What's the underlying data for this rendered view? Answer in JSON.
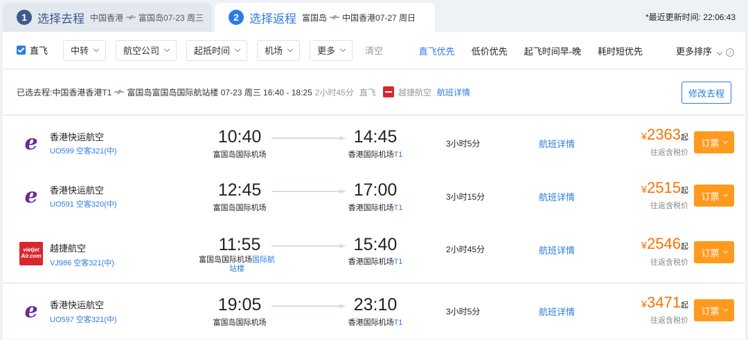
{
  "steps": [
    {
      "num": "1",
      "title": "选择去程",
      "from": "中国香港",
      "to": "富国岛07-23 周三"
    },
    {
      "num": "2",
      "title": "选择返程",
      "from": "富国岛",
      "to": "中国香港07-27 周日"
    }
  ],
  "update_time": "*最近更新时间: 22:06:43",
  "filters": {
    "direct_label": "直飞",
    "direct_checked": true,
    "dropdowns": [
      "中转",
      "航空公司",
      "起抵时间",
      "机场",
      "更多"
    ],
    "clear": "清空"
  },
  "sorts": [
    "直飞优先",
    "低价优先",
    "起飞时间早-晚",
    "耗时短优先",
    "更多排序"
  ],
  "active_sort": "直飞优先",
  "selected": {
    "prefix": "已选去程: ",
    "from": "中国香港香港T1",
    "to": "富国岛富国岛国际航站楼 07-23 周三 16:40 - 18:25",
    "duration": "2小时45分",
    "type": "直飞",
    "airline": "越捷航空",
    "detail": "航班详情",
    "modify": "修改去程"
  },
  "flights": [
    {
      "airline": "香港快运航空",
      "flight_no": "UO599 空客321(中)",
      "dep_time": "10:40",
      "dep_airport": "富国岛国际机场",
      "dep_term": "",
      "arr_time": "14:45",
      "arr_airport": "香港国际机场",
      "arr_term": "T1",
      "duration": "3小时5分",
      "detail": "航班详情",
      "currency": "¥",
      "price": "2363",
      "price_suffix": "起",
      "tax_note": "往返含税价",
      "book": "订票",
      "logo": "hk-express-logo"
    },
    {
      "airline": "香港快运航空",
      "flight_no": "UO591 空客320(中)",
      "dep_time": "12:45",
      "dep_airport": "富国岛国际机场",
      "dep_term": "",
      "arr_time": "17:00",
      "arr_airport": "香港国际机场",
      "arr_term": "T1",
      "duration": "3小时15分",
      "detail": "航班详情",
      "currency": "¥",
      "price": "2515",
      "price_suffix": "起",
      "tax_note": "往返含税价",
      "book": "订票",
      "logo": "hk-express-logo"
    },
    {
      "airline": "越捷航空",
      "flight_no": "VJ986 空客321(中)",
      "dep_time": "11:55",
      "dep_airport": "富国岛国际机场",
      "dep_term": "国际航站楼",
      "arr_time": "15:40",
      "arr_airport": "香港国际机场",
      "arr_term": "T1",
      "duration": "2小时45分",
      "detail": "航班详情",
      "currency": "¥",
      "price": "2546",
      "price_suffix": "起",
      "tax_note": "往返含税价",
      "book": "订票",
      "logo": "vietjet-logo"
    },
    {
      "airline": "香港快运航空",
      "flight_no": "UO597 空客321(中)",
      "dep_time": "19:05",
      "dep_airport": "富国岛国际机场",
      "dep_term": "",
      "arr_time": "23:10",
      "arr_airport": "香港国际机场",
      "arr_term": "T1",
      "duration": "3小时5分",
      "detail": "航班详情",
      "currency": "¥",
      "price": "3471",
      "price_suffix": "起",
      "tax_note": "往返含税价",
      "book": "订票",
      "logo": "hk-express-logo"
    }
  ],
  "colors": {
    "accent": "#2b7be5",
    "price": "#ff6f00",
    "book_button": "#ff9a1f",
    "vietjet_red": "#d9272e",
    "hk_express_purple": "#6a2b9a"
  }
}
